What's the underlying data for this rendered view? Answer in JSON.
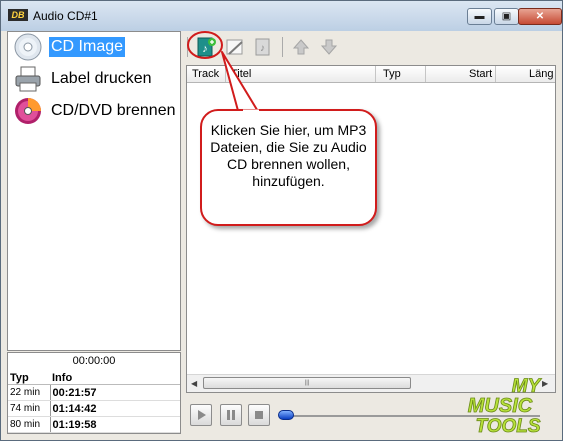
{
  "window": {
    "title": "Audio CD#1",
    "logo": "DB",
    "minimize": "▬",
    "maximize": "▣",
    "close": "✕"
  },
  "sidebar": {
    "items": [
      {
        "label": "CD Image",
        "icon": "cd-icon",
        "selected": true
      },
      {
        "label": "Label drucken",
        "icon": "printer-icon",
        "selected": false
      },
      {
        "label": "CD/DVD brennen",
        "icon": "burn-disc-icon",
        "selected": false
      }
    ]
  },
  "info_panel": {
    "time": "00:00:00",
    "headers": [
      "Typ",
      "Info"
    ],
    "rows": [
      {
        "typ": "22 min",
        "info": "00:21:57"
      },
      {
        "typ": "74 min",
        "info": "01:14:42"
      },
      {
        "typ": "80 min",
        "info": "01:19:58"
      }
    ]
  },
  "toolbar": {
    "buttons": [
      "add-mp3-icon",
      "edit-icon",
      "remove-icon",
      "move-up-icon",
      "move-down-icon"
    ]
  },
  "tracklist": {
    "columns": [
      "Track",
      "Titel",
      "Typ",
      "Start",
      "Läng"
    ],
    "rows": []
  },
  "callout": {
    "text": "Klicken Sie hier, um MP3 Dateien, die Sie zu Audio CD brennen wollen, hinzufügen."
  },
  "player": {
    "buttons": [
      "play-icon",
      "pause-icon",
      "stop-icon"
    ],
    "position": 0
  },
  "watermark": {
    "line1": "MY",
    "line2": "MUSIC",
    "line3": "TOOLS"
  },
  "colors": {
    "selection": "#3399ff",
    "callout_border": "#d11c1c",
    "watermark": "#b8e23a"
  }
}
